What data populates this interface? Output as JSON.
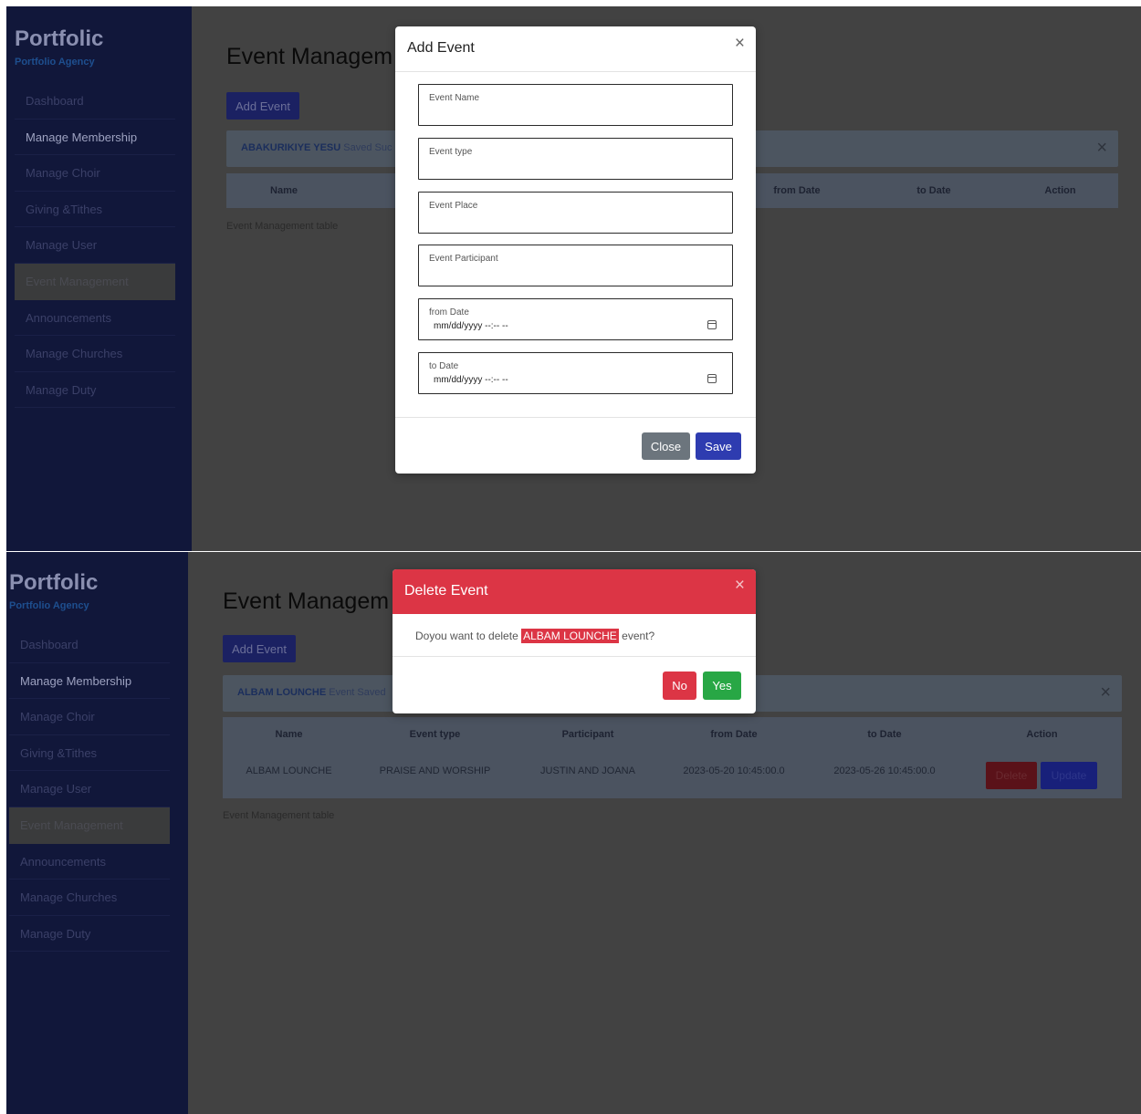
{
  "brand": {
    "title": "Portfolic",
    "subtitle": "Portfolio Agency"
  },
  "sidebar": {
    "items": [
      {
        "label": "Dashboard"
      },
      {
        "label": "Manage Membership"
      },
      {
        "label": "Manage Choir"
      },
      {
        "label": "Giving &Tithes"
      },
      {
        "label": "Manage User"
      },
      {
        "label": "Event Management"
      },
      {
        "label": "Announcements"
      },
      {
        "label": "Manage Churches"
      },
      {
        "label": "Manage Duty"
      }
    ],
    "active_item": "Event Management"
  },
  "page": {
    "title": "Event Managem",
    "add_button": "Add Event",
    "caption": "Event Management table",
    "columns": [
      "Name",
      "Event type",
      "Participant",
      "from Date",
      "to Date",
      "Action"
    ]
  },
  "screen1": {
    "alert": {
      "name": "ABAKURIKIYE YESU",
      "text": "Saved Suc"
    },
    "header_visible": [
      "Name",
      "from Date",
      "to Date",
      "Action"
    ],
    "modal": {
      "title": "Add Event",
      "close_glyph": "×",
      "fields": [
        {
          "label": "Event Name",
          "value": ""
        },
        {
          "label": "Event type",
          "value": ""
        },
        {
          "label": "Event Place",
          "value": ""
        },
        {
          "label": "Event Participant",
          "value": ""
        },
        {
          "label": "from Date",
          "value": "mm/dd/yyyy --:-- --"
        },
        {
          "label": "to Date",
          "value": "mm/dd/yyyy --:-- --"
        }
      ],
      "close_button": "Close",
      "save_button": "Save"
    }
  },
  "screen2": {
    "alert": {
      "name": "ALBAM LOUNCHE",
      "text": "Event Saved"
    },
    "row": {
      "name": "ALBAM LOUNCHE",
      "event_type": "PRAISE AND WORSHIP",
      "participant": "JUSTIN AND JOANA",
      "from_date": "2023-05-20 10:45:00.0",
      "to_date": "2023-05-26 10:45:00.0",
      "delete_button": "Delete",
      "update_button": "Update"
    },
    "modal": {
      "title": "Delete Event",
      "close_glyph": "×",
      "prefix": "Doyou want to delete",
      "event_name": "ALBAM LOUNCHE",
      "suffix": "event?",
      "no_button": "No",
      "yes_button": "Yes"
    }
  },
  "colors": {
    "sidebar_bg": "#11173a",
    "overlay_bg": "#424242",
    "primary": "#2e3cb0",
    "danger": "#dc3545",
    "success": "#28a745",
    "secondary": "#6c757d"
  }
}
